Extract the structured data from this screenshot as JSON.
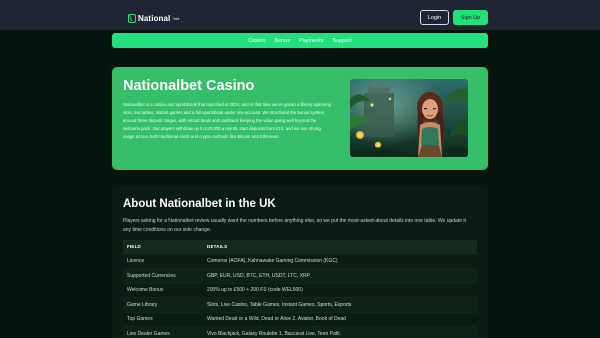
{
  "header": {
    "logo_text": "National",
    "logo_suffix": "bet",
    "login_label": "Login",
    "signup_label": "Sign Up"
  },
  "nav": {
    "items": [
      {
        "label": "Casino"
      },
      {
        "label": "Bonus"
      },
      {
        "label": "Payments"
      },
      {
        "label": "Support"
      }
    ]
  },
  "hero": {
    "title": "Nationalbet Casino",
    "text": "Nationalbet is a casino and sportsbook that launched in 2024, and in that time we've grown a library spanning slots, live tables, instant games and a full sportsbook under one account. We structured the bonus system around three deposit stages, with reload deals and cashback keeping the value going well beyond the welcome pack. Our players withdraw up to £20,000 a month, start deposits from £10, and we see strong usage across both traditional cards and crypto methods like Bitcoin and Ethereum."
  },
  "about": {
    "title": "About Nationalbet in the UK",
    "text": "Players asking for a Nationalbet review usually want the numbers before anything else, so we put the most-asked-about details into one table. We update it any time conditions on our side change.",
    "table": {
      "headers": [
        "FIELD",
        "DETAILS"
      ],
      "rows": [
        {
          "field": "Licence",
          "details": "Comoros (AOFA), Kahnawake Gaming Commission (KGC)"
        },
        {
          "field": "Supported Currencies",
          "details": "GBP, EUR, USD, BTC, ETH, USDT, LTC, XRP"
        },
        {
          "field": "Welcome Bonus",
          "details": "200% up to £500 + 200 FS (code WEL500)"
        },
        {
          "field": "Game Library",
          "details": "Slots, Live Casino, Table Games, Instant Games, Sports, Esports"
        },
        {
          "field": "Top Games",
          "details": "Wanted Dead or a Wild, Dead or Alive 2, Aviator, Book of Dead"
        },
        {
          "field": "Live Dealer Games",
          "details": "Vivo Blackjack, Galaxy Roulette 1, Baccarat Live, Teen Patti"
        }
      ]
    }
  },
  "colors": {
    "accent": "#22e07a",
    "hero_bg": "#37be68",
    "page_bg": "#07150e",
    "topbar_bg": "#1f2533"
  }
}
